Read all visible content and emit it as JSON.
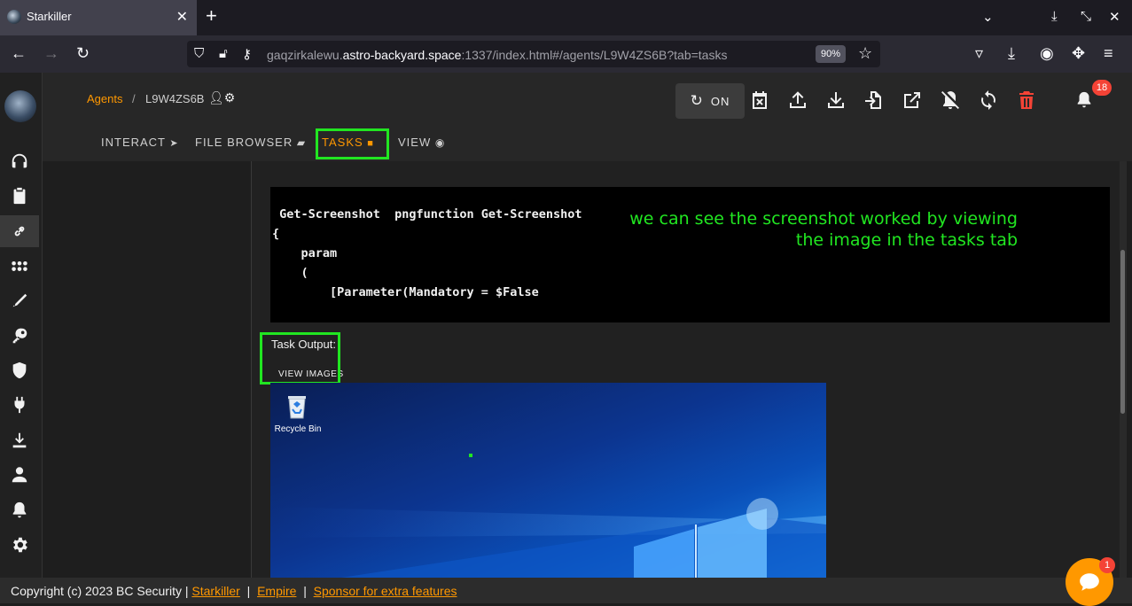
{
  "browser": {
    "tab_title": "Starkiller",
    "url_host_prefix": "gaqzirkalewu.",
    "url_domain": "astro-backyard.space",
    "url_rest": ":1337/index.html#/agents/L9W4ZS6B?tab=tasks",
    "zoom": "90%"
  },
  "breadcrumb": {
    "agents": "Agents",
    "separator": "/",
    "agent_id": "L9W4ZS6B"
  },
  "toolbar": {
    "toggle_label": "ON",
    "notification_count": "18"
  },
  "tabs": [
    {
      "label": "INTERACT"
    },
    {
      "label": "FILE BROWSER"
    },
    {
      "label": "TASKS"
    },
    {
      "label": "VIEW"
    }
  ],
  "code": {
    "line1": " Get-Screenshot  pngfunction Get-Screenshot",
    "line2": "{",
    "line3": "    param",
    "line4": "    (",
    "line5": "        [Parameter(Mandatory = $False"
  },
  "annotation": {
    "line1": "we can see the screenshot worked by viewing",
    "line2": "the image in the tasks tab"
  },
  "task": {
    "output_label": "Task Output:",
    "view_images": "VIEW IMAGES",
    "desktop_icon_label": "Recycle Bin"
  },
  "footer": {
    "copyright": "Copyright (c) 2023 BC Security |",
    "link1": "Starkiller",
    "sep": "|",
    "link2": "Empire",
    "link3": "Sponsor for extra features"
  },
  "chat": {
    "badge": "1"
  },
  "colors": {
    "accent": "#ff9800",
    "annotation": "#21e621",
    "badge": "#f44336"
  }
}
